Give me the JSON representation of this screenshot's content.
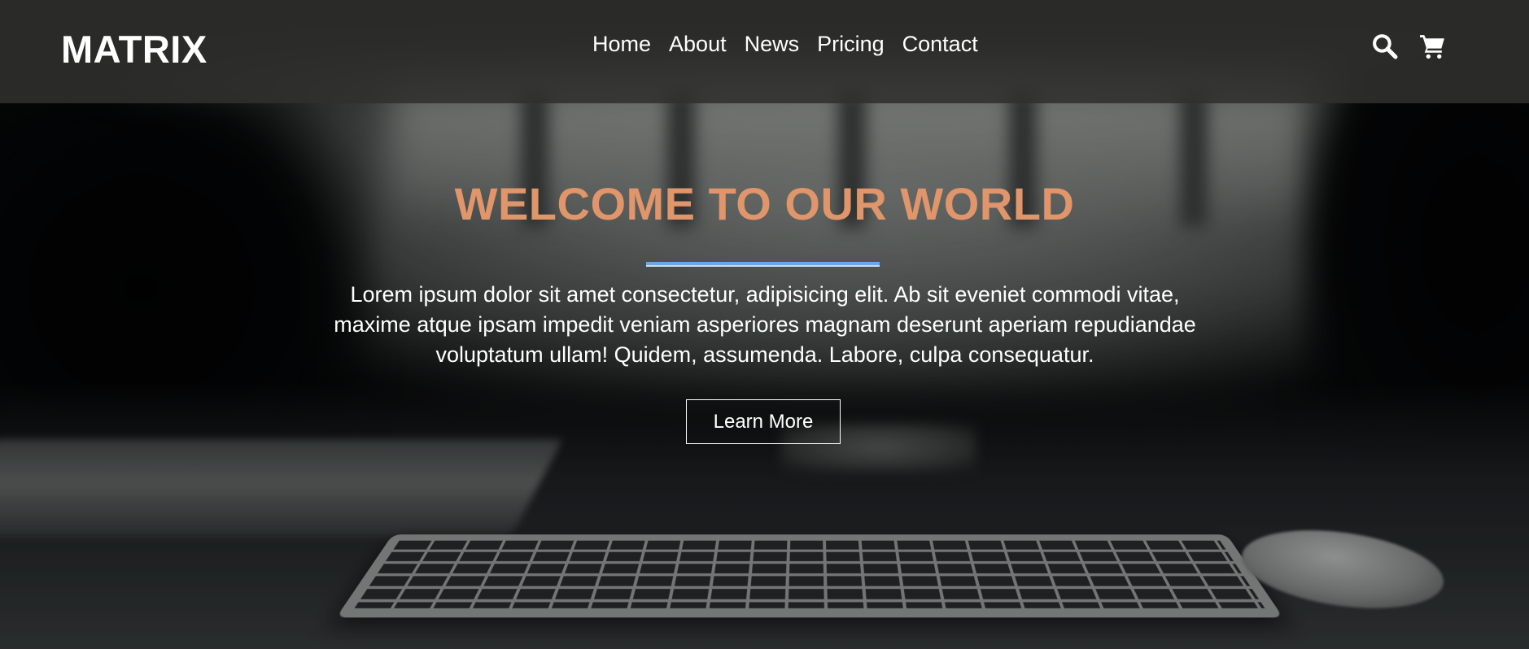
{
  "brand": {
    "logo": "MATRIX"
  },
  "nav": {
    "items": [
      "Home",
      "About",
      "News",
      "Pricing",
      "Contact"
    ]
  },
  "header_icons": {
    "search": "search-icon",
    "cart": "cart-icon"
  },
  "hero": {
    "title": "WELCOME TO OUR WORLD",
    "text_lines": [
      "Lorem ipsum dolor sit amet consectetur, adipisicing elit. Ab sit eveniet commodi vitae,",
      "maxime atque ipsam impedit veniam asperiores magnam deserunt aperiam repudiandae",
      "voluptatum ullam! Quidem, assumenda. Labore, culpa consequatur."
    ],
    "button_label": "Learn More"
  },
  "colors": {
    "title": "#e0956a",
    "rule": "#6aa7ea",
    "navbar": "#30302e",
    "text": "#ffffff"
  }
}
